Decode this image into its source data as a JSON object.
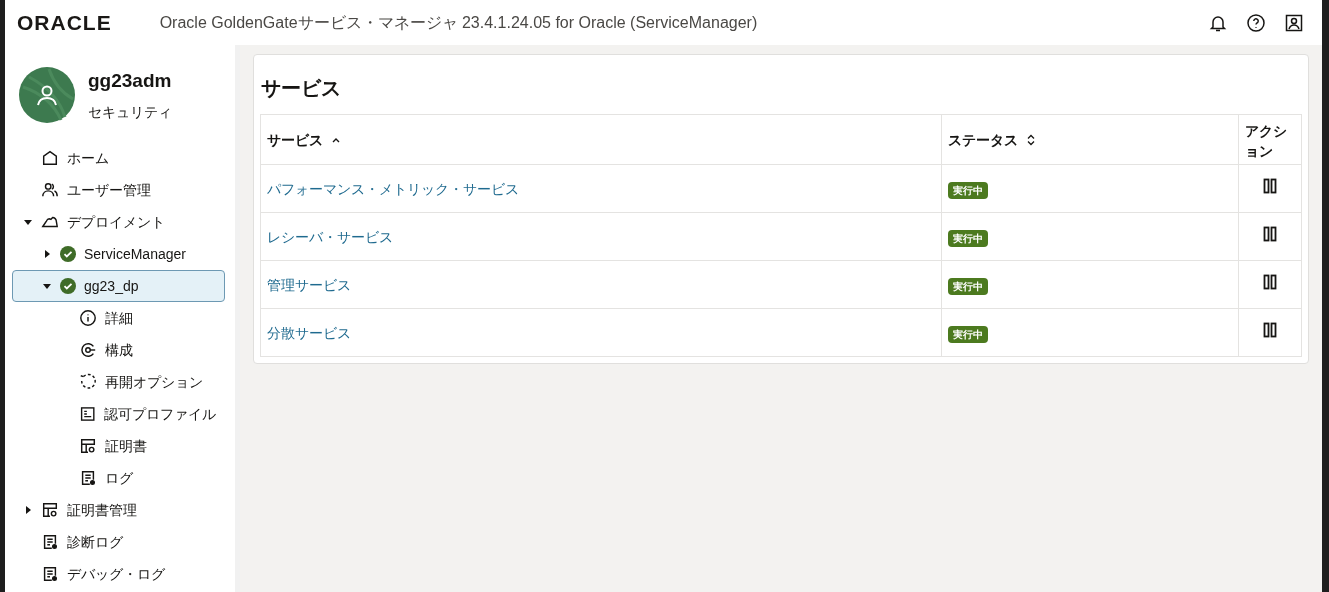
{
  "header": {
    "logo": "ORACLE",
    "title": "Oracle GoldenGateサービス・マネージャ 23.4.1.24.05 for Oracle (ServiceManager)"
  },
  "sidebar": {
    "user": {
      "name": "gg23adm",
      "role": "セキュリティ"
    },
    "nav": [
      {
        "label": "ホーム",
        "kind": "home",
        "selected": false
      },
      {
        "label": "ユーザー管理",
        "kind": "users",
        "selected": false
      },
      {
        "label": "デプロイメント",
        "kind": "cloud",
        "selected": false,
        "expanded": true,
        "children": [
          {
            "label": "ServiceManager",
            "kind": "check",
            "selected": false,
            "expanded": false
          },
          {
            "label": "gg23_dp",
            "kind": "check",
            "selected": true,
            "expanded": true,
            "children": [
              {
                "label": "詳細",
                "kind": "info",
                "selected": false
              },
              {
                "label": "構成",
                "kind": "config",
                "selected": false
              },
              {
                "label": "再開オプション",
                "kind": "restart",
                "selected": false
              },
              {
                "label": "認可プロファイル",
                "kind": "profile",
                "selected": false
              },
              {
                "label": "証明書",
                "kind": "cert",
                "selected": false
              },
              {
                "label": "ログ",
                "kind": "log",
                "selected": false
              }
            ]
          }
        ]
      },
      {
        "label": "証明書管理",
        "kind": "cert",
        "selected": false,
        "expanded": false
      },
      {
        "label": "診断ログ",
        "kind": "log",
        "selected": false
      },
      {
        "label": "デバッグ・ログ",
        "kind": "log",
        "selected": false
      }
    ]
  },
  "main": {
    "title": "サービス",
    "table": {
      "columns": [
        {
          "label": "サービス",
          "kind": "sorted-asc"
        },
        {
          "label": "ステータス",
          "kind": "sortable"
        },
        {
          "label": "アクション",
          "kind": "plain"
        }
      ],
      "rows": [
        {
          "service": "パフォーマンス・メトリック・サービス",
          "status": "実行中"
        },
        {
          "service": "レシーバ・サービス",
          "status": "実行中"
        },
        {
          "service": "管理サービス",
          "status": "実行中"
        },
        {
          "service": "分散サービス",
          "status": "実行中"
        }
      ]
    }
  }
}
